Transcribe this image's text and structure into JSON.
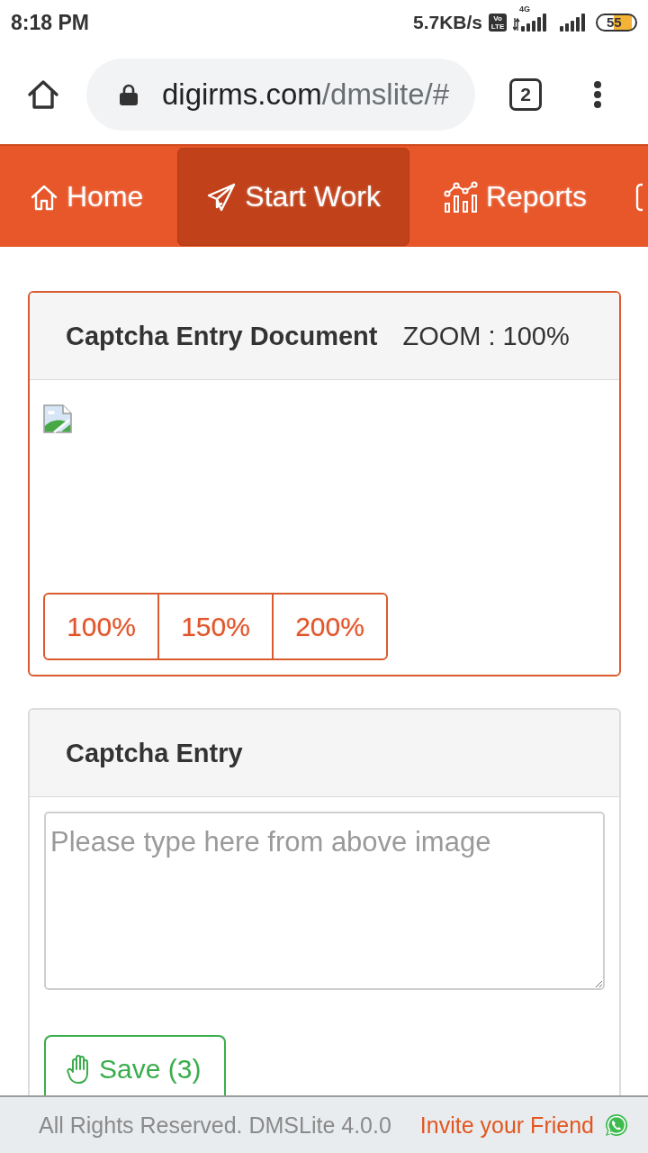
{
  "status_bar": {
    "time": "8:18 PM",
    "network_speed": "5.7KB/s",
    "volte_badge": "Vo LTE",
    "network_type": "4G",
    "battery": "55"
  },
  "browser_bar": {
    "url_host": "digirms.com",
    "url_path": "/dmslite/#",
    "tab_count": "2"
  },
  "nav": {
    "items": [
      {
        "label": "Home",
        "selected": false
      },
      {
        "label": "Start Work",
        "selected": true
      },
      {
        "label": "Reports",
        "selected": false
      }
    ]
  },
  "document_card": {
    "title": "Captcha Entry Document",
    "zoom_label": "ZOOM : 100%",
    "zoom_buttons": [
      {
        "label": "100%"
      },
      {
        "label": "150%"
      },
      {
        "label": "200%"
      }
    ]
  },
  "entry_card": {
    "title": "Captcha Entry",
    "input": {
      "placeholder": "Please type here from above image"
    },
    "save_button": {
      "label": "Save (3)"
    }
  },
  "footer": {
    "copyright": "All Rights Reserved. DMSLite 4.0.0",
    "invite_link": "Invite your Friend"
  }
}
